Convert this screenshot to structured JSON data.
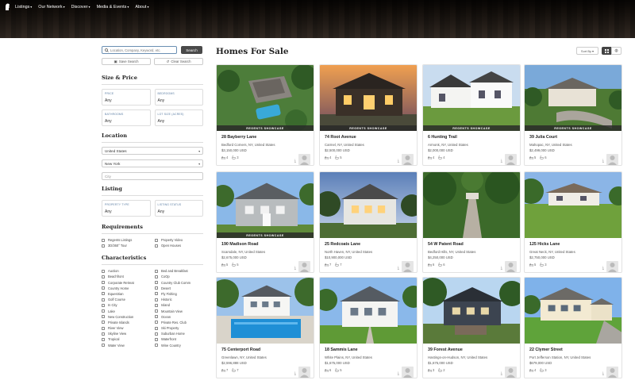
{
  "nav": {
    "items": [
      "Listings",
      "Our Network",
      "Discover",
      "Media & Events",
      "About"
    ]
  },
  "search": {
    "placeholder": "Location, Company, Keyword, etc.",
    "button_label": "Search",
    "save_label": "Save Search",
    "clear_label": "Clear Search"
  },
  "size_price": {
    "title": "Size & Price",
    "fields": [
      {
        "label": "PRICE",
        "value": "Any"
      },
      {
        "label": "BEDROOMS",
        "value": "Any"
      },
      {
        "label": "BATHROOMS",
        "value": "Any"
      },
      {
        "label": "LOT SIZE (ACRES)",
        "value": "Any"
      }
    ]
  },
  "location": {
    "title": "Location",
    "country": "United States",
    "state": "New York",
    "city_placeholder": "City"
  },
  "listing": {
    "title": "Listing",
    "fields": [
      {
        "label": "PROPERTY TYPE",
        "value": "Any"
      },
      {
        "label": "LISTING STATUS",
        "value": "Any"
      }
    ]
  },
  "requirements": {
    "title": "Requirements",
    "items": [
      "Regents Listings",
      "Property Video",
      "3D/360° Tour",
      "Open Houses"
    ]
  },
  "characteristics": {
    "title": "Characteristics",
    "items": [
      "Auction",
      "Bed and Breakfast",
      "Beachfront",
      "CoOp",
      "Corporate Retreat",
      "Country Club Comm",
      "Country Home",
      "Desert",
      "Equestrian",
      "Fly Fishing",
      "Golf Course",
      "Historic",
      "In City",
      "Island",
      "Lake",
      "Mountain View",
      "New Construction",
      "Ocean",
      "Private Islands",
      "Private Res. Club",
      "River View",
      "Ski Property",
      "Skyline View",
      "Suburban Home",
      "Tropical",
      "Waterfront",
      "Water View",
      "Wine Country"
    ]
  },
  "main": {
    "title": "Homes For Sale",
    "sort_label": "Sort By"
  },
  "showcase_label": "REGENTS SHOWCASE",
  "listings": [
    {
      "address": "28 Bayberry Lane",
      "city": "Bedford Corners, NY, United States",
      "price": "$3,150,000 USD",
      "beds": "4",
      "baths": "3",
      "showcase": true,
      "scene": "aerial-pool"
    },
    {
      "address": "74 Root Avenue",
      "city": "Carmel, NY, United States",
      "price": "$2,500,000 USD",
      "beds": "4",
      "baths": "5",
      "showcase": true,
      "scene": "dusk"
    },
    {
      "address": "6 Hunting Trail",
      "city": "Armonk, NY, United States",
      "price": "$2,000,000 USD",
      "beds": "4",
      "baths": "4",
      "showcase": true,
      "scene": "white-modern"
    },
    {
      "address": "39 Julia Court",
      "city": "Mahopac, NY, United States",
      "price": "$2,499,000 USD",
      "beds": "5",
      "baths": "6",
      "showcase": true,
      "scene": "aerial-estate"
    },
    {
      "address": "190 Madison Road",
      "city": "Scarsdale, NY, United States",
      "price": "$2,675,000 USD",
      "beds": "5",
      "baths": "5",
      "showcase": true,
      "scene": "shingle"
    },
    {
      "address": "25 Redcoats Lane",
      "city": "North Haven, NY, United States",
      "price": "$10,900,000 USD",
      "beds": "7",
      "baths": "7",
      "showcase": false,
      "scene": "twilight"
    },
    {
      "address": "54 W Patent Road",
      "city": "Bedford Hills, NY, United States",
      "price": "$4,250,000 USD",
      "beds": "6",
      "baths": "6",
      "showcase": false,
      "scene": "driveway"
    },
    {
      "address": "125 Hicks Lane",
      "city": "Great Neck, NY, United States",
      "price": "$2,750,000 USD",
      "beds": "5",
      "baths": "3",
      "showcase": false,
      "scene": "ranch"
    },
    {
      "address": "75 Centerport Road",
      "city": "Greenlawn, NY, United States",
      "price": "$2,596,888 USD",
      "beds": "7",
      "baths": "7",
      "showcase": false,
      "scene": "pool"
    },
    {
      "address": "18 Sammis Lane",
      "city": "White Plains, NY, United States",
      "price": "$1,675,000 USD",
      "beds": "6",
      "baths": "5",
      "showcase": false,
      "scene": "colonial"
    },
    {
      "address": "39 Forest Avenue",
      "city": "Hastings-on-Hudson, NY, United States",
      "price": "$1,675,000 USD",
      "beds": "3",
      "baths": "2",
      "showcase": false,
      "scene": "dark-house"
    },
    {
      "address": "22 Clymer Street",
      "city": "Port Jefferson Station, NY, United States",
      "price": "$679,000 USD",
      "beds": "4",
      "baths": "3",
      "showcase": false,
      "scene": "cream-house"
    }
  ]
}
